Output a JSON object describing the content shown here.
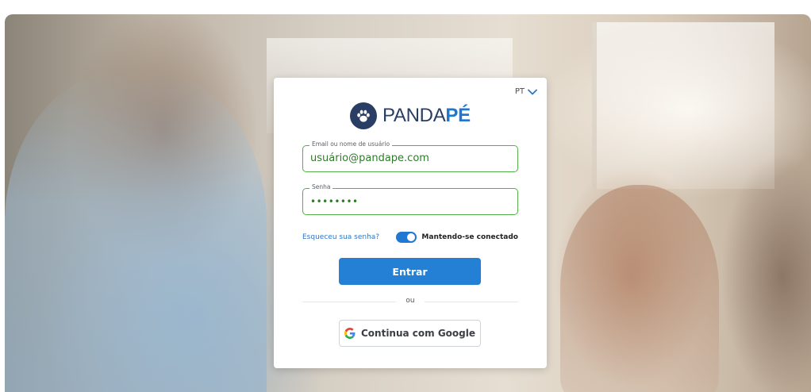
{
  "colors": {
    "brand_navy": "#2a3d64",
    "brand_blue": "#1f77d0",
    "primary_button": "#2380d4",
    "input_border": "#54b04a",
    "link": "#2f76c7"
  },
  "header": {
    "language": "PT",
    "language_icon": "chevron-down-icon"
  },
  "brand": {
    "logo_icon": "paw-icon",
    "name_part1": "PANDA",
    "name_part2": "PÉ"
  },
  "form": {
    "email": {
      "label": "Email ou nome de usuário",
      "value": "usuário@pandape.com"
    },
    "password": {
      "label": "Senha",
      "value": "••••••••"
    },
    "forgot_link": "Esqueceu sua senha?",
    "keep_connected": {
      "label": "Mantendo-se conectado",
      "enabled": true
    },
    "submit_label": "Entrar",
    "divider_text": "ou",
    "google_button": {
      "label": "Continua com Google",
      "icon": "google-g-icon"
    }
  }
}
